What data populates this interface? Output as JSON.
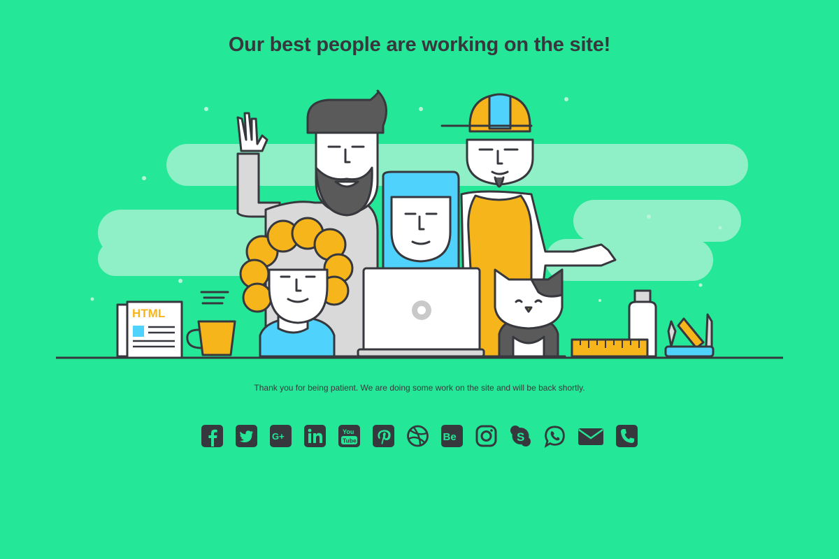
{
  "headline": "Our best people are working on the site!",
  "notice": "Thank you for being patient. We are doing some work on the site and will be back shortly.",
  "illustration": {
    "newspaper_label": "HTML"
  },
  "colors": {
    "background": "#24e897",
    "cloud": "#8ff0c7",
    "dark": "#36383d",
    "yellow": "#f7b51c",
    "blue": "#4fd2fb",
    "gray": "#d9d9d9"
  },
  "social_icons": [
    {
      "name": "facebook-icon"
    },
    {
      "name": "twitter-icon"
    },
    {
      "name": "google-plus-icon"
    },
    {
      "name": "linkedin-icon"
    },
    {
      "name": "youtube-icon"
    },
    {
      "name": "pinterest-icon"
    },
    {
      "name": "dribbble-icon"
    },
    {
      "name": "behance-icon"
    },
    {
      "name": "instagram-icon"
    },
    {
      "name": "skype-icon"
    },
    {
      "name": "whatsapp-icon"
    },
    {
      "name": "email-icon"
    },
    {
      "name": "phone-icon"
    }
  ]
}
